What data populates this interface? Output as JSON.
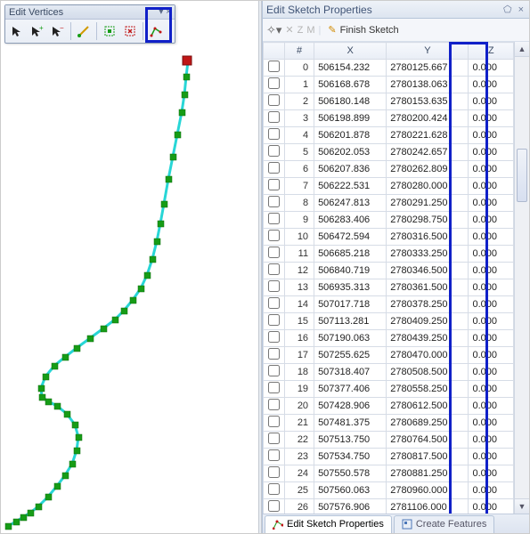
{
  "left": {
    "toolbar_title": "Edit Vertices"
  },
  "right": {
    "panel_title": "Edit Sketch Properties",
    "toolbar": {
      "z_label": "Z",
      "m_label": "M",
      "finish_label": "Finish Sketch"
    },
    "headers": {
      "num": "#",
      "x": "X",
      "y": "Y",
      "z": "Z"
    },
    "rows": [
      {
        "n": 0,
        "x": "506154.232",
        "y": "2780125.667",
        "z": "0.000"
      },
      {
        "n": 1,
        "x": "506168.678",
        "y": "2780138.063",
        "z": "0.000"
      },
      {
        "n": 2,
        "x": "506180.148",
        "y": "2780153.635",
        "z": "0.000"
      },
      {
        "n": 3,
        "x": "506198.899",
        "y": "2780200.424",
        "z": "0.000"
      },
      {
        "n": 4,
        "x": "506201.878",
        "y": "2780221.628",
        "z": "0.000"
      },
      {
        "n": 5,
        "x": "506202.053",
        "y": "2780242.657",
        "z": "0.000"
      },
      {
        "n": 6,
        "x": "506207.836",
        "y": "2780262.809",
        "z": "0.000"
      },
      {
        "n": 7,
        "x": "506222.531",
        "y": "2780280.000",
        "z": "0.000"
      },
      {
        "n": 8,
        "x": "506247.813",
        "y": "2780291.250",
        "z": "0.000"
      },
      {
        "n": 9,
        "x": "506283.406",
        "y": "2780298.750",
        "z": "0.000"
      },
      {
        "n": 10,
        "x": "506472.594",
        "y": "2780316.500",
        "z": "0.000"
      },
      {
        "n": 11,
        "x": "506685.218",
        "y": "2780333.250",
        "z": "0.000"
      },
      {
        "n": 12,
        "x": "506840.719",
        "y": "2780346.500",
        "z": "0.000"
      },
      {
        "n": 13,
        "x": "506935.313",
        "y": "2780361.500",
        "z": "0.000"
      },
      {
        "n": 14,
        "x": "507017.718",
        "y": "2780378.250",
        "z": "0.000"
      },
      {
        "n": 15,
        "x": "507113.281",
        "y": "2780409.250",
        "z": "0.000"
      },
      {
        "n": 16,
        "x": "507190.063",
        "y": "2780439.250",
        "z": "0.000"
      },
      {
        "n": 17,
        "x": "507255.625",
        "y": "2780470.000",
        "z": "0.000"
      },
      {
        "n": 18,
        "x": "507318.407",
        "y": "2780508.500",
        "z": "0.000"
      },
      {
        "n": 19,
        "x": "507377.406",
        "y": "2780558.250",
        "z": "0.000"
      },
      {
        "n": 20,
        "x": "507428.906",
        "y": "2780612.500",
        "z": "0.000"
      },
      {
        "n": 21,
        "x": "507481.375",
        "y": "2780689.250",
        "z": "0.000"
      },
      {
        "n": 22,
        "x": "507513.750",
        "y": "2780764.500",
        "z": "0.000"
      },
      {
        "n": 23,
        "x": "507534.750",
        "y": "2780817.500",
        "z": "0.000"
      },
      {
        "n": 24,
        "x": "507550.578",
        "y": "2780881.250",
        "z": "0.000"
      },
      {
        "n": 25,
        "x": "507560.063",
        "y": "2780960.000",
        "z": "0.000"
      },
      {
        "n": 26,
        "x": "507576.906",
        "y": "2781106.000",
        "z": "0.000"
      }
    ],
    "tabs": {
      "active": "Edit Sketch Properties",
      "inactive": "Create Features"
    }
  }
}
